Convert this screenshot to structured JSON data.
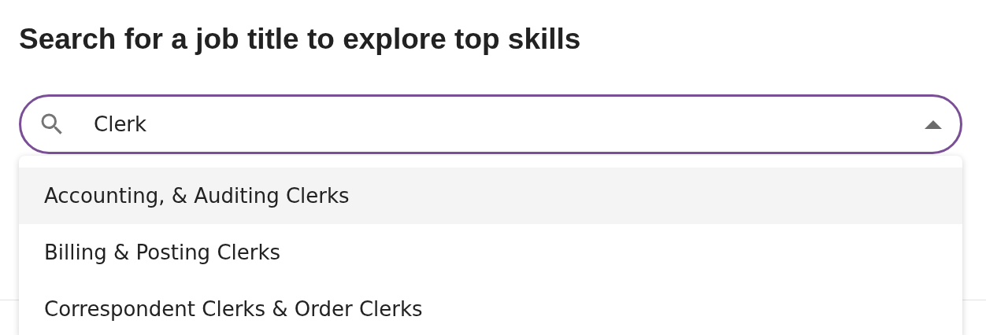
{
  "heading": "Search for a job title to explore top skills",
  "search": {
    "value": "Clerk",
    "expanded": true
  },
  "options": [
    {
      "label": "Accounting, & Auditing Clerks",
      "selected": true
    },
    {
      "label": "Billing & Posting Clerks",
      "selected": false
    },
    {
      "label": "Correspondent Clerks & Order Clerks",
      "selected": false
    }
  ]
}
